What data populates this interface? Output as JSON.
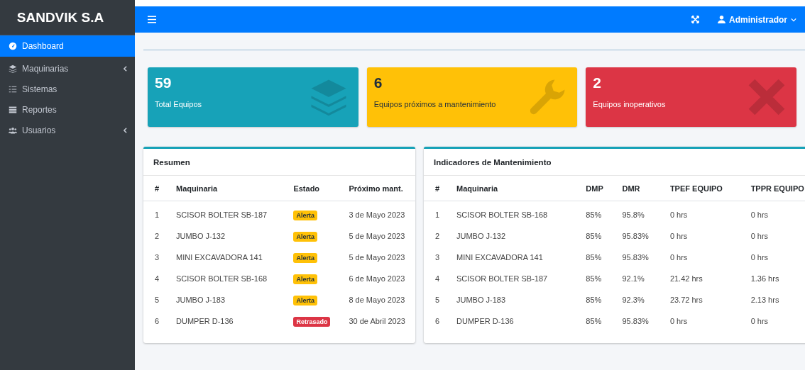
{
  "brand": "SANDVIK S.A",
  "sidebar": {
    "items": [
      {
        "label": "Dashboard",
        "selected": true,
        "expandable": false
      },
      {
        "label": "Maquinarias",
        "selected": false,
        "expandable": true
      },
      {
        "label": "Sistemas",
        "selected": false,
        "expandable": false
      },
      {
        "label": "Reportes",
        "selected": false,
        "expandable": false
      },
      {
        "label": "Usuarios",
        "selected": false,
        "expandable": true
      }
    ]
  },
  "topbar": {
    "user": "Administrador"
  },
  "stat_cards": [
    {
      "value": "59",
      "label": "Total Equipos",
      "kind": "info"
    },
    {
      "value": "6",
      "label": "Equipos próximos a mantenimiento",
      "kind": "warning"
    },
    {
      "value": "2",
      "label": "Equipos inoperativos",
      "kind": "danger"
    }
  ],
  "summary": {
    "title": "Resumen",
    "columns": [
      "#",
      "Maquinaria",
      "Estado",
      "Próximo mant."
    ],
    "rows": [
      {
        "n": "1",
        "machine": "SCISOR BOLTER SB-187",
        "status": {
          "label": "Alerta",
          "kind": "warning"
        },
        "next": "3 de Mayo 2023"
      },
      {
        "n": "2",
        "machine": "JUMBO J-132",
        "status": {
          "label": "Alerta",
          "kind": "warning"
        },
        "next": "5 de Mayo 2023"
      },
      {
        "n": "3",
        "machine": "MINI EXCAVADORA 141",
        "status": {
          "label": "Alerta",
          "kind": "warning"
        },
        "next": "5 de Mayo 2023"
      },
      {
        "n": "4",
        "machine": "SCISOR BOLTER SB-168",
        "status": {
          "label": "Alerta",
          "kind": "warning"
        },
        "next": "6 de Mayo 2023"
      },
      {
        "n": "5",
        "machine": "JUMBO J-183",
        "status": {
          "label": "Alerta",
          "kind": "warning"
        },
        "next": "8 de Mayo 2023"
      },
      {
        "n": "6",
        "machine": "DUMPER D-136",
        "status": {
          "label": "Retrasado",
          "kind": "danger"
        },
        "next": "30 de Abril 2023"
      }
    ]
  },
  "indicators": {
    "title": "Indicadores de Mantenimiento",
    "columns": [
      "#",
      "Maquinaria",
      "DMP",
      "DMR",
      "TPEF EQUIPO",
      "TPPR EQUIPO"
    ],
    "rows": [
      [
        "1",
        "SCISOR BOLTER SB-168",
        "85%",
        "95.8%",
        "0 hrs",
        "0 hrs"
      ],
      [
        "2",
        "JUMBO J-132",
        "85%",
        "95.83%",
        "0 hrs",
        "0 hrs"
      ],
      [
        "3",
        "MINI EXCAVADORA 141",
        "85%",
        "95.83%",
        "0 hrs",
        "0 hrs"
      ],
      [
        "4",
        "SCISOR BOLTER SB-187",
        "85%",
        "92.1%",
        "21.42 hrs",
        "1.36 hrs"
      ],
      [
        "5",
        "JUMBO J-183",
        "85%",
        "92.3%",
        "23.72 hrs",
        "2.13 hrs"
      ],
      [
        "6",
        "DUMPER D-136",
        "85%",
        "95.83%",
        "0 hrs",
        "0 hrs"
      ]
    ]
  }
}
